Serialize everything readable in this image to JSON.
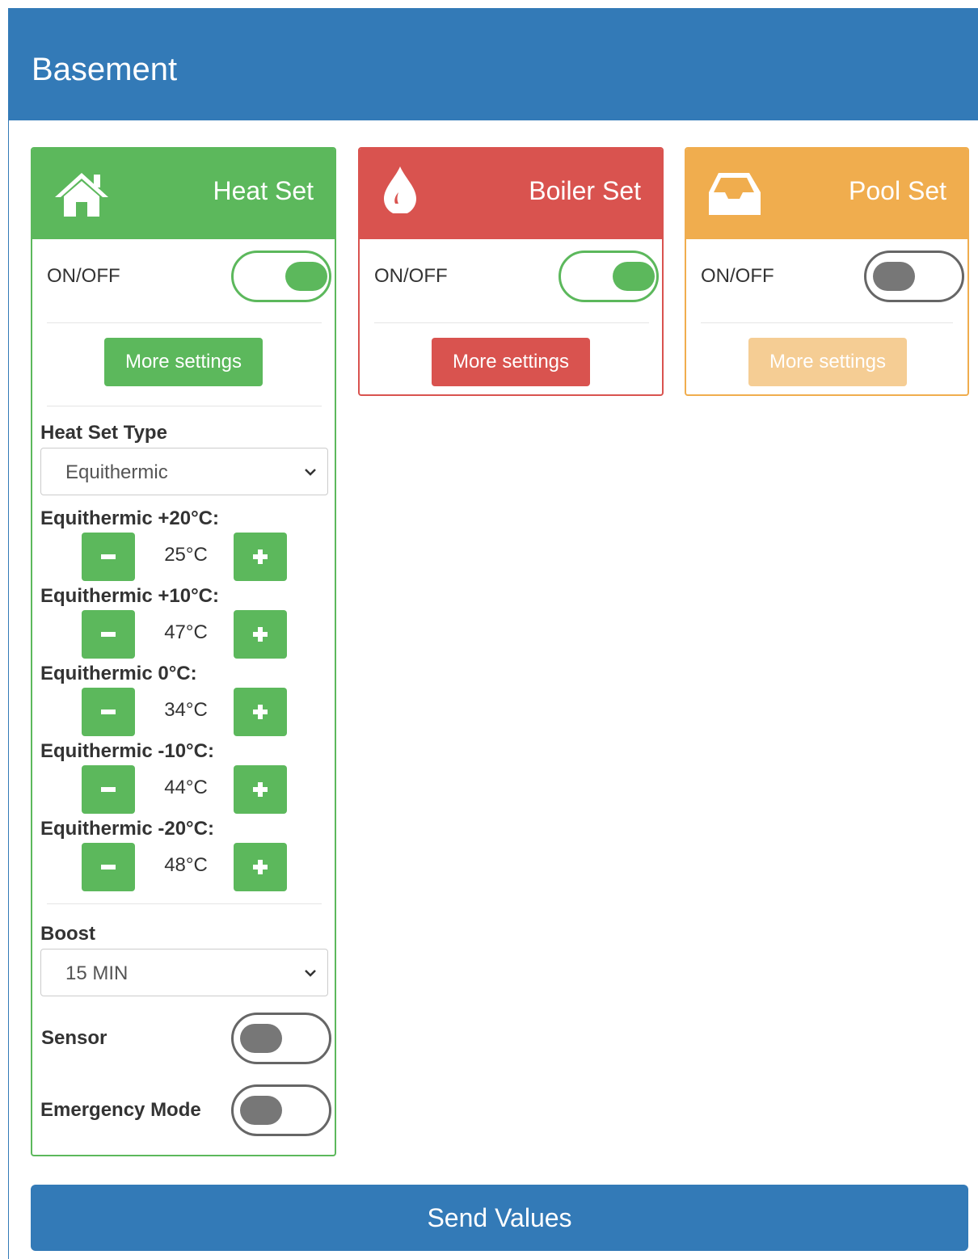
{
  "panel": {
    "title": "Basement"
  },
  "colors": {
    "primary": "#337ab7",
    "success": "#5cb85c",
    "danger": "#d9534f",
    "warning": "#f0ad4e"
  },
  "cards": {
    "heat": {
      "title": "Heat Set",
      "icon": "home-icon",
      "onoff_label": "ON/OFF",
      "on": true,
      "more_label": "More settings",
      "type_label": "Heat Set Type",
      "type_value": "Equithermic",
      "equithermic": [
        {
          "label": "Equithermic +20°C:",
          "value": "25°C"
        },
        {
          "label": "Equithermic +10°C:",
          "value": "47°C"
        },
        {
          "label": "Equithermic 0°C:",
          "value": "34°C"
        },
        {
          "label": "Equithermic -10°C:",
          "value": "44°C"
        },
        {
          "label": "Equithermic -20°C:",
          "value": "48°C"
        }
      ],
      "boost_label": "Boost",
      "boost_value": "15 MIN",
      "sensor_label": "Sensor",
      "sensor_on": false,
      "emergency_label": "Emergency Mode",
      "emergency_on": false
    },
    "boiler": {
      "title": "Boiler Set",
      "icon": "drop-icon",
      "onoff_label": "ON/OFF",
      "on": true,
      "more_label": "More settings"
    },
    "pool": {
      "title": "Pool Set",
      "icon": "inbox-icon",
      "onoff_label": "ON/OFF",
      "on": false,
      "more_label": "More settings",
      "more_disabled": true
    }
  },
  "send_label": "Send Values"
}
